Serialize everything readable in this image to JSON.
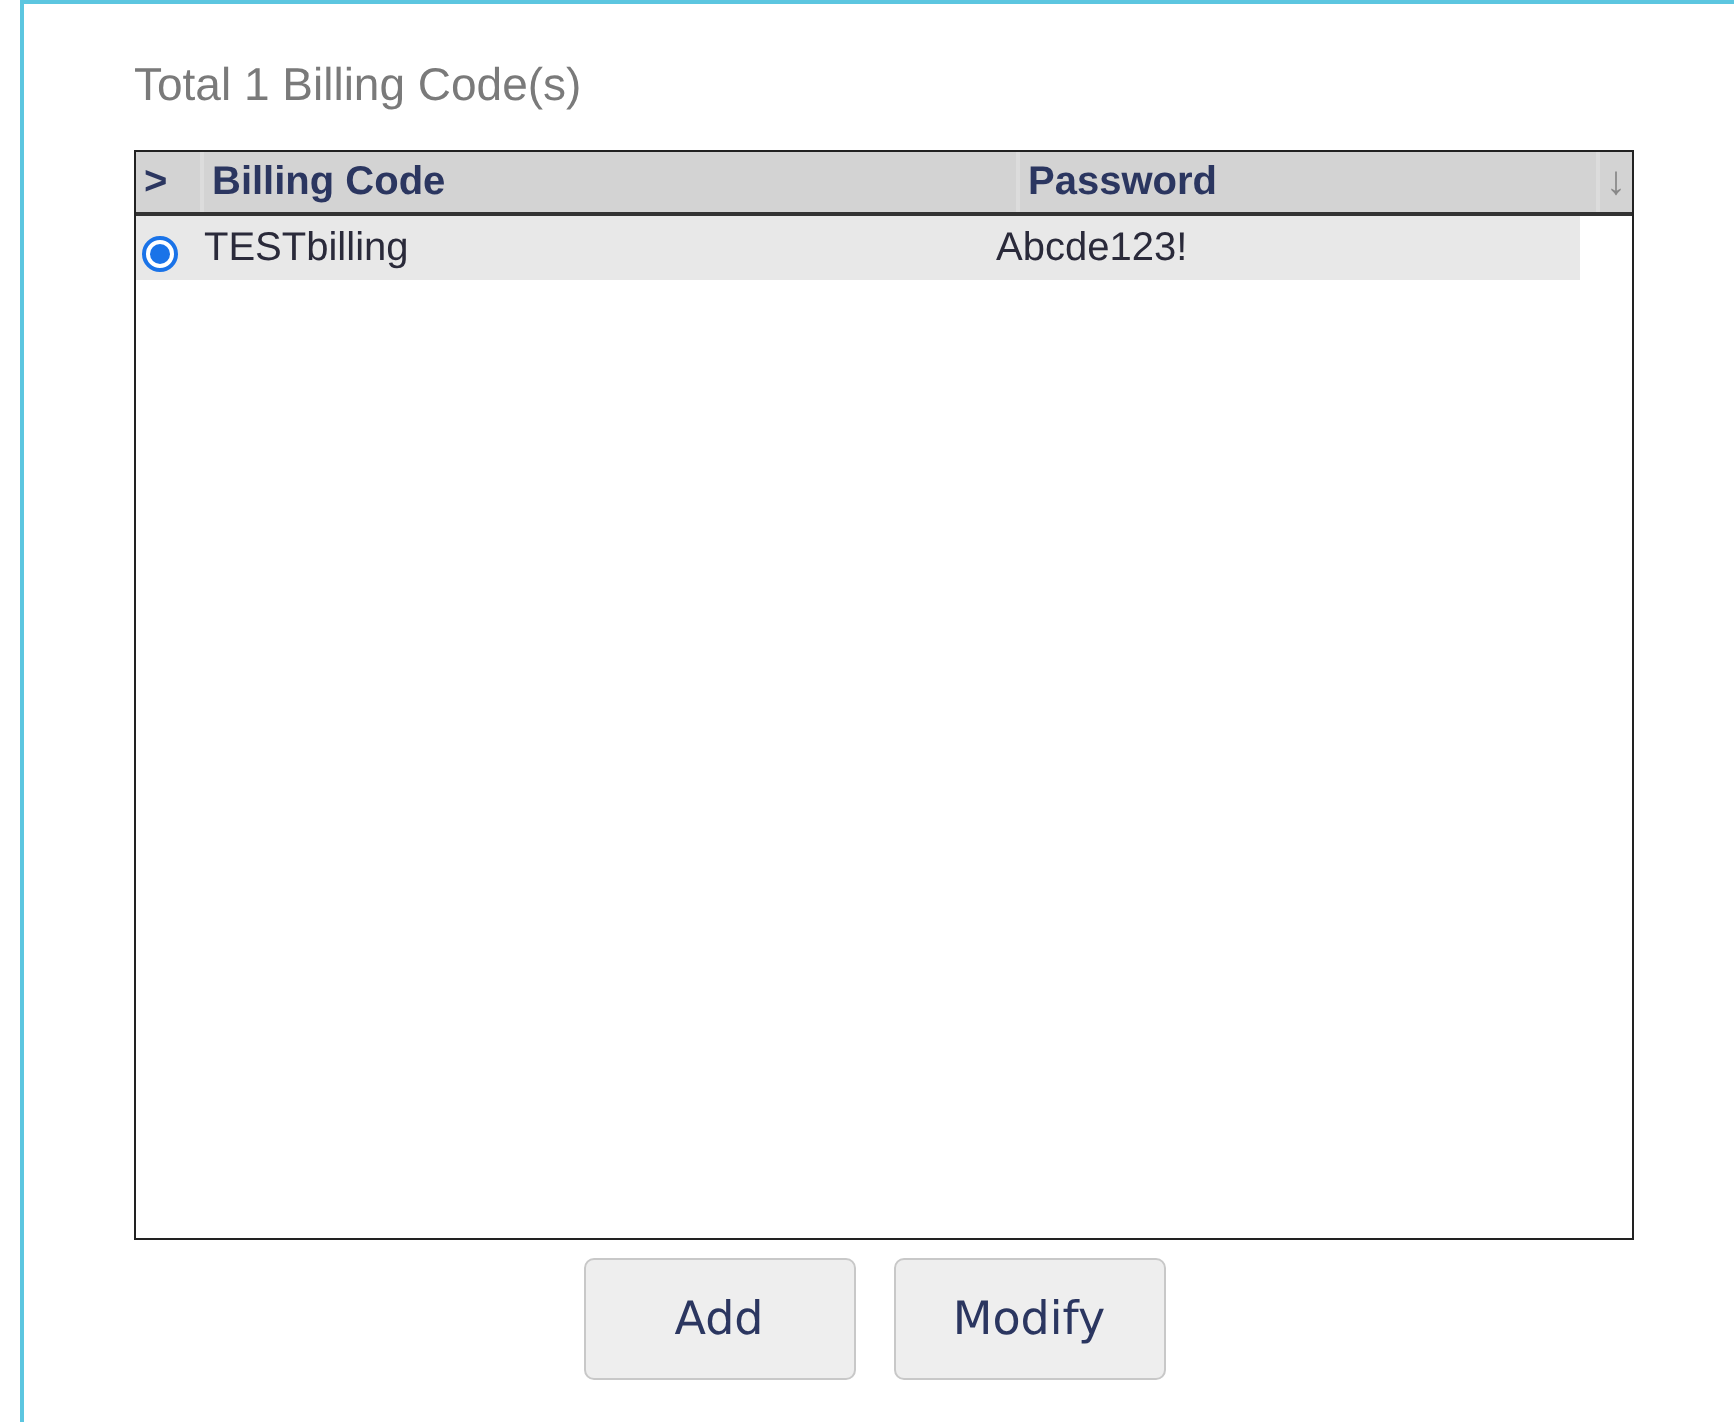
{
  "title": "Total 1 Billing Code(s)",
  "table": {
    "selector_header": ">",
    "columns": [
      "Billing Code",
      "Password"
    ],
    "sort_indicator": "↓",
    "rows": [
      {
        "selected": true,
        "cells": [
          "TESTbilling",
          "Abcde123!"
        ]
      }
    ]
  },
  "buttons": [
    "Add",
    "Modify"
  ]
}
